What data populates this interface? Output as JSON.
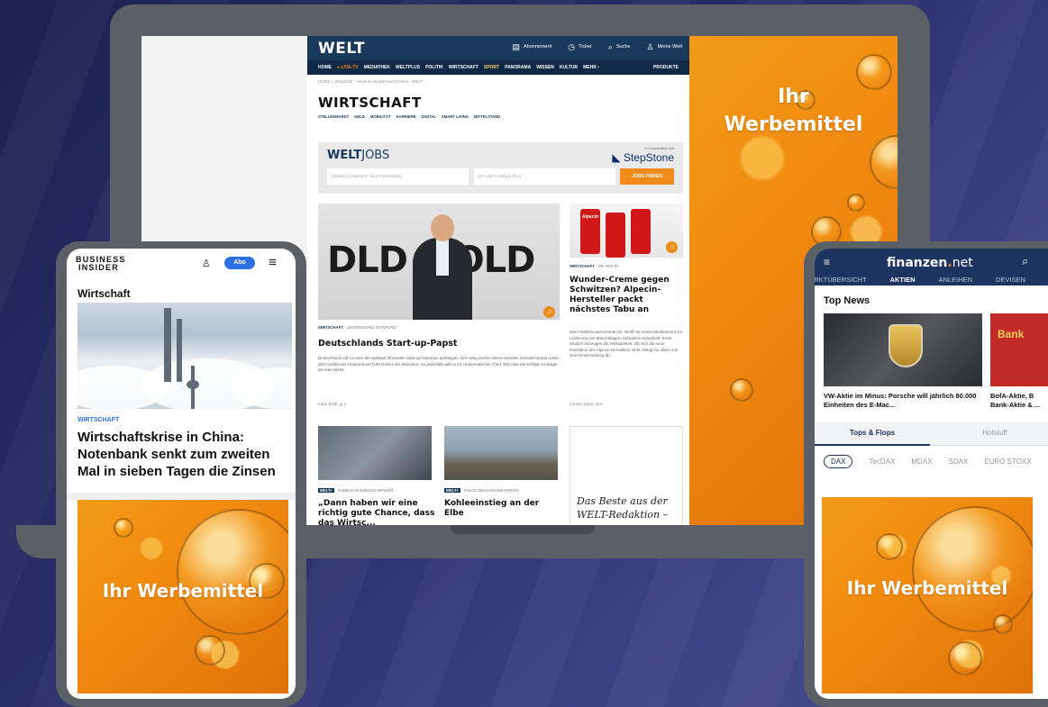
{
  "ad": {
    "label": "Ihr Werbemittel",
    "label_line1": "Ihr",
    "label_line2": "Werbemittel"
  },
  "welt": {
    "logo": "WELT",
    "topnav": [
      {
        "icon": "document-icon",
        "label": "Abonnement"
      },
      {
        "icon": "clock-icon",
        "label": "Ticker"
      },
      {
        "icon": "search-icon",
        "label": "Suche"
      },
      {
        "icon": "user-icon",
        "label": "Meine Welt"
      }
    ],
    "nav": [
      "HOME",
      "● LIVE-TV",
      "MEDIATHEK",
      "WELTPLUS",
      "POLITIK",
      "WIRTSCHAFT",
      "SPORT",
      "PANORAMA",
      "WISSEN",
      "KULTUR",
      "MEHR ›",
      "PRODUKTE"
    ],
    "breadcrumb": "HOME » Wirtschaft - News & Aktuelle Nachrichten - WELT",
    "section_title": "WIRTSCHAFT",
    "subnav": [
      "STELLENMARKT",
      "GELD",
      "MOBILITÄT",
      "KARRIERE",
      "DIGITAL",
      "SMART LIVING",
      "MITTELSTAND"
    ],
    "jobs": {
      "logo_bold": "WELT",
      "logo_light": "JOBS",
      "coop": "In Kooperation mit",
      "partner": "StepStone",
      "field1_placeholder": "(Jobtitel, Kompetenz oder Firmenname)",
      "field2_placeholder": "(Ort oder 5-stellige PLZ)",
      "button": "JOBS FINDEN"
    },
    "hero": {
      "image_text": "DLD",
      "image_text2": "OLD",
      "kicker": "WIRTSCHAFT",
      "kicker_sub": "„BAYERISCHES STANFORD“",
      "headline": "Deutschlands Start-up-Papst",
      "teaser": "Deutschland soll zu einer der weltweit führenden Start-up-Nationen aufsteigen. Den Weg dorthin ebnen könnten Gründerzentren nach dem Vorbild der UnternehmerTUM GmbH aus München. So jedenfalls will es ihr charismatischer Chef. Die Liste der Erfolge ist länger als man denkt.",
      "author": "Klaus Boldt",
      "comments": "2"
    },
    "side": {
      "kicker": "WIRTSCHAFT",
      "kicker_sub": "DR. WOLFF",
      "headline": "Wunder-Creme gegen Schwitzen? Alpecin-Hersteller packt nächstes Tabu an",
      "can_label": "Alpecin",
      "teaser": "Das Familienunternehmen Dr. Wolff hat neues Medikament zur Linderung von übermäßigem Schwitzen entwickelt. Erste Studien bezeugen die Wirksamkeit. Ob sich die neue Investition des Alpecin-Herstellers lohnt, hängt vor allem von einer Entscheidung ab.",
      "author": "Carsten Dierig",
      "comments": "8"
    },
    "card1": {
      "badge": "WELT+",
      "kicker": "HABECK IM BÜRGER-VERHÖR",
      "headline": "„Dann haben wir eine richtig gute Chance,",
      "headline2": "dass das Wirtsc..."
    },
    "card2": {
      "badge": "WELT+",
      "kicker": "FOLGE DES UKRAINE-KRIEGS",
      "headline": "Kohleeinstieg an der Elbe"
    },
    "best": {
      "text": "Das Beste aus der WELT-Redaktion –"
    }
  },
  "bi": {
    "logo_line1": "BUSINESS",
    "logo_line2": "INSIDER",
    "abo": "Abo",
    "section": "Wirtschaft",
    "kicker": "WIRTSCHAFT",
    "headline": "Wirtschaftskrise in China: Notenbank senkt zum zweiten Mal in sieben Tagen die Zinsen"
  },
  "fn": {
    "logo": "finanzen",
    "logo_net": "net",
    "logo_dot": ".",
    "tabs": [
      "MARKTÜBERSICHT",
      "AKTIEN",
      "ANLEIHEN",
      "DEVISEN"
    ],
    "section": "Top News",
    "news1": "VW-Aktie im Minus: Porsche will jährlich 80.000 Einheiten des E-Mac...",
    "news2_line1": "BofA-Aktie, B",
    "news2_line2": "Bank-Aktie & ...",
    "img2_text": "Bank",
    "subtabs": [
      "Tops & Flops",
      "Hotstuff"
    ],
    "chips": [
      "DAX",
      "TecDAX",
      "MDAX",
      "SDAX",
      "EURO STOXX"
    ]
  }
}
